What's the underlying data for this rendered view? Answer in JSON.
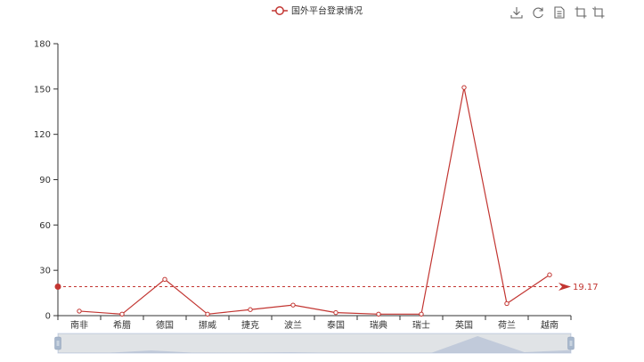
{
  "chart_data": {
    "type": "line",
    "categories": [
      "南非",
      "希腊",
      "德国",
      "挪威",
      "捷克",
      "波兰",
      "泰国",
      "瑞典",
      "瑞士",
      "英国",
      "荷兰",
      "越南"
    ],
    "series": [
      {
        "name": "国外平台登录情况",
        "values": [
          3,
          1,
          24,
          1,
          4,
          7,
          2,
          1,
          1,
          151,
          8,
          27
        ],
        "color": "#c23531"
      }
    ],
    "y_ticks": [
      0,
      30,
      60,
      90,
      120,
      150,
      180
    ],
    "ylim": [
      0,
      180
    ],
    "legend_position": "top-center",
    "grid": false,
    "mark_line": {
      "type": "average",
      "value": 19.17,
      "label": "19.17",
      "color": "#c23531"
    },
    "data_zoom": {
      "type": "slider",
      "start_percent": 0,
      "end_percent": 100
    },
    "toolbox": [
      "save-as-image-icon",
      "restore-icon",
      "data-view-icon",
      "zoom-icon",
      "zoom-reset-icon"
    ]
  }
}
